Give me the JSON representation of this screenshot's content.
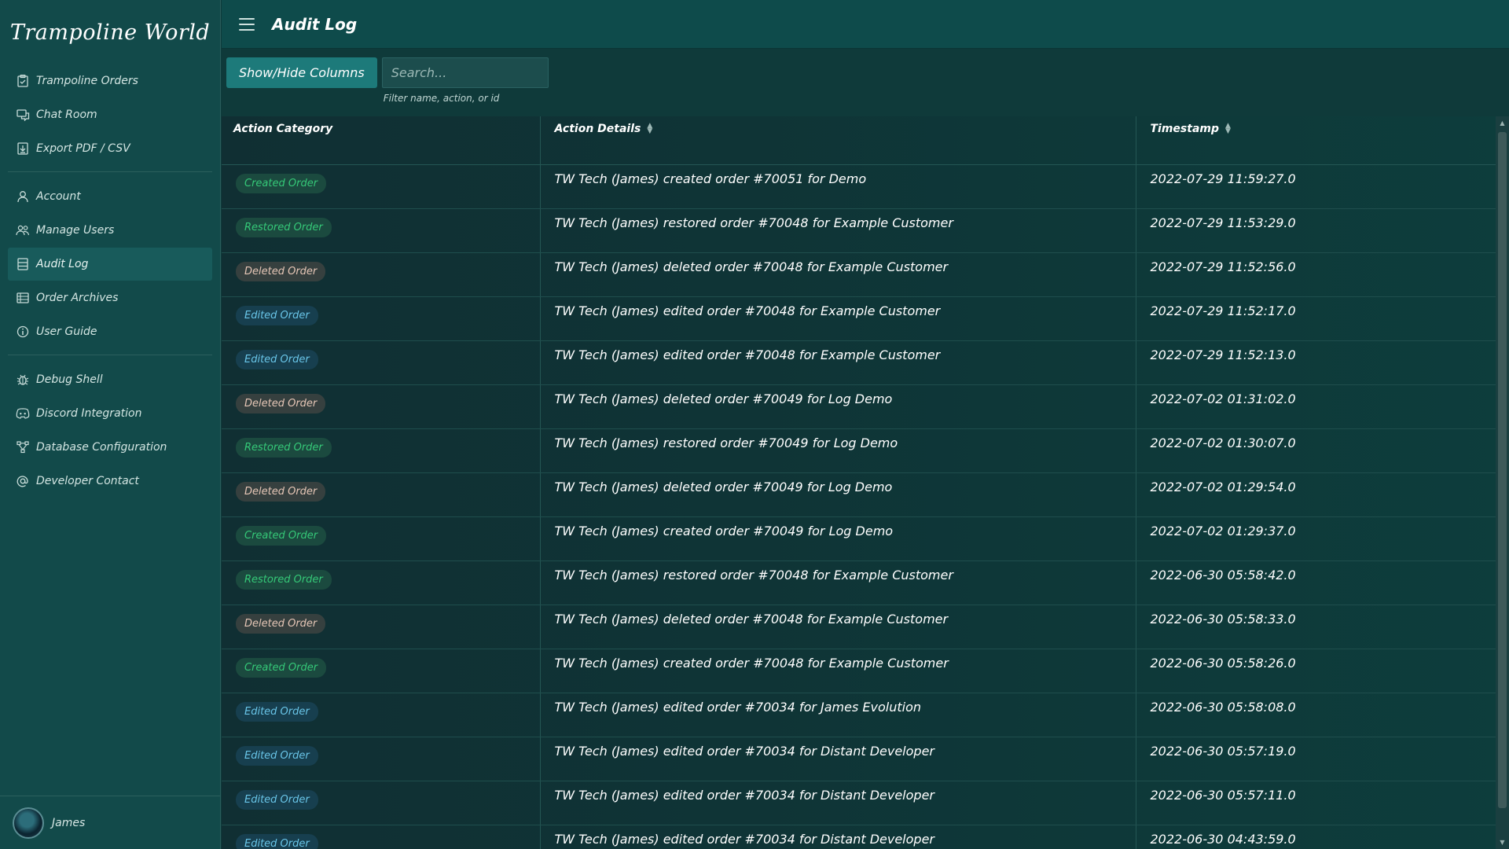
{
  "brand": "Trampoline World",
  "header": {
    "title": "Audit Log"
  },
  "sidebar": {
    "items": [
      {
        "label": "Trampoline Orders",
        "icon": "clipboard-icon"
      },
      {
        "label": "Chat Room",
        "icon": "chat-icon"
      },
      {
        "label": "Export PDF / CSV",
        "icon": "export-icon"
      },
      {
        "label": "Account",
        "icon": "user-icon"
      },
      {
        "label": "Manage Users",
        "icon": "users-icon"
      },
      {
        "label": "Audit Log",
        "icon": "list-icon",
        "active": true
      },
      {
        "label": "Order Archives",
        "icon": "archive-icon"
      },
      {
        "label": "User Guide",
        "icon": "info-icon"
      },
      {
        "label": "Debug Shell",
        "icon": "bug-icon"
      },
      {
        "label": "Discord Integration",
        "icon": "discord-icon"
      },
      {
        "label": "Database Configuration",
        "icon": "database-icon"
      },
      {
        "label": "Developer Contact",
        "icon": "at-icon"
      }
    ]
  },
  "user": {
    "name": "James"
  },
  "toolbar": {
    "columns_label": "Show/Hide Columns",
    "search_placeholder": "Search...",
    "search_help": "Filter name, action, or id"
  },
  "table": {
    "columns": [
      "Action Category",
      "Action Details",
      "Timestamp"
    ],
    "rows": [
      {
        "category": "Created Order",
        "type": "created",
        "details": "TW Tech (James) created order #70051 for Demo",
        "timestamp": "2022-07-29 11:59:27.0"
      },
      {
        "category": "Restored Order",
        "type": "restored",
        "details": "TW Tech (James) restored order #70048 for Example Customer",
        "timestamp": "2022-07-29 11:53:29.0"
      },
      {
        "category": "Deleted Order",
        "type": "deleted",
        "details": "TW Tech (James) deleted order #70048 for Example Customer",
        "timestamp": "2022-07-29 11:52:56.0"
      },
      {
        "category": "Edited Order",
        "type": "edited",
        "details": "TW Tech (James) edited order #70048 for Example Customer",
        "timestamp": "2022-07-29 11:52:17.0"
      },
      {
        "category": "Edited Order",
        "type": "edited",
        "details": "TW Tech (James) edited order #70048 for Example Customer",
        "timestamp": "2022-07-29 11:52:13.0"
      },
      {
        "category": "Deleted Order",
        "type": "deleted",
        "details": "TW Tech (James) deleted order #70049 for Log Demo",
        "timestamp": "2022-07-02 01:31:02.0"
      },
      {
        "category": "Restored Order",
        "type": "restored",
        "details": "TW Tech (James) restored order #70049 for Log Demo",
        "timestamp": "2022-07-02 01:30:07.0"
      },
      {
        "category": "Deleted Order",
        "type": "deleted",
        "details": "TW Tech (James) deleted order #70049 for Log Demo",
        "timestamp": "2022-07-02 01:29:54.0"
      },
      {
        "category": "Created Order",
        "type": "created",
        "details": "TW Tech (James) created order #70049 for Log Demo",
        "timestamp": "2022-07-02 01:29:37.0"
      },
      {
        "category": "Restored Order",
        "type": "restored",
        "details": "TW Tech (James) restored order #70048 for Example Customer",
        "timestamp": "2022-06-30 05:58:42.0"
      },
      {
        "category": "Deleted Order",
        "type": "deleted",
        "details": "TW Tech (James) deleted order #70048 for Example Customer",
        "timestamp": "2022-06-30 05:58:33.0"
      },
      {
        "category": "Created Order",
        "type": "created",
        "details": "TW Tech (James) created order #70048 for Example Customer",
        "timestamp": "2022-06-30 05:58:26.0"
      },
      {
        "category": "Edited Order",
        "type": "edited",
        "details": "TW Tech (James) edited order #70034 for James Evolution",
        "timestamp": "2022-06-30 05:58:08.0"
      },
      {
        "category": "Edited Order",
        "type": "edited",
        "details": "TW Tech (James) edited order #70034 for Distant Developer",
        "timestamp": "2022-06-30 05:57:19.0"
      },
      {
        "category": "Edited Order",
        "type": "edited",
        "details": "TW Tech (James) edited order #70034 for Distant Developer",
        "timestamp": "2022-06-30 05:57:11.0"
      },
      {
        "category": "Edited Order",
        "type": "edited",
        "details": "TW Tech (James) edited order #70034 for Distant Developer",
        "timestamp": "2022-06-30 04:43:59.0"
      }
    ]
  },
  "colors": {
    "sidebar_bg": "#124a4a",
    "header_bg": "#0e4b4b",
    "accent": "#1d7a7a",
    "badge_green": "#35c978",
    "badge_blue": "#69c5e8",
    "badge_tan": "#e7c7b7"
  }
}
